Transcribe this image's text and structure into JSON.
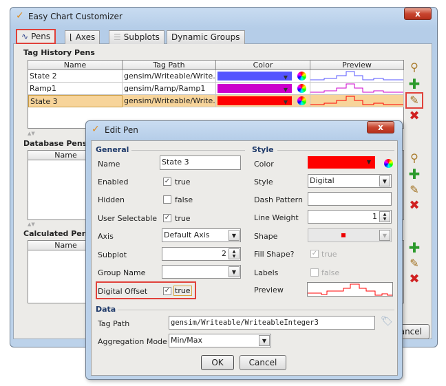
{
  "window": {
    "title": "Easy Chart Customizer",
    "close": "x"
  },
  "tabs": [
    {
      "label": "Pens",
      "icon": "line-chart-icon"
    },
    {
      "label": "Axes",
      "icon": "axes-icon"
    },
    {
      "label": "Subplots",
      "icon": "subplots-icon"
    },
    {
      "label": "Dynamic Groups"
    }
  ],
  "tag_history": {
    "label": "Tag History Pens",
    "columns": [
      "Name",
      "Tag Path",
      "Color",
      "Preview"
    ],
    "rows": [
      {
        "name": "State 2",
        "path": "gensim/Writeable/Write...",
        "color": "#5555ff"
      },
      {
        "name": "Ramp1",
        "path": "gensim/Ramp/Ramp1",
        "color": "#cc00cc"
      },
      {
        "name": "State 3",
        "path": "gensim/Writeable/Write...",
        "color": "#ff0000",
        "selected": true
      }
    ]
  },
  "database_pens": {
    "label": "Database Pens",
    "columns": [
      "Name"
    ]
  },
  "calculated_pens": {
    "label": "Calculated Pens",
    "columns": [
      "Name"
    ]
  },
  "side_icons": [
    "search-icon",
    "add-icon",
    "edit-icon",
    "delete-icon"
  ],
  "bg_cancel": "Cancel",
  "dialog": {
    "title": "Edit Pen",
    "close": "x",
    "general": {
      "header": "General",
      "name_label": "Name",
      "name_value": "State 3",
      "enabled_label": "Enabled",
      "enabled": "true",
      "hidden_label": "Hidden",
      "hidden": "false",
      "selectable_label": "User Selectable",
      "selectable": "true",
      "axis_label": "Axis",
      "axis": "Default Axis",
      "subplot_label": "Subplot",
      "subplot": "2",
      "group_label": "Group Name",
      "group": "",
      "offset_label": "Digital Offset",
      "offset": "true"
    },
    "style": {
      "header": "Style",
      "color_label": "Color",
      "color": "#ff0000",
      "style_label": "Style",
      "style": "Digital",
      "dash_label": "Dash Pattern",
      "dash": "",
      "weight_label": "Line Weight",
      "weight": "1",
      "shape_label": "Shape",
      "fill_label": "Fill Shape?",
      "fill": "true",
      "labels_label": "Labels",
      "labels": "false",
      "preview_label": "Preview"
    },
    "data": {
      "header": "Data",
      "path_label": "Tag Path",
      "path": "gensim/Writeable/WriteableInteger3",
      "agg_label": "Aggregation Mode",
      "agg": "Min/Max"
    },
    "ok": "OK",
    "cancel": "Cancel"
  }
}
